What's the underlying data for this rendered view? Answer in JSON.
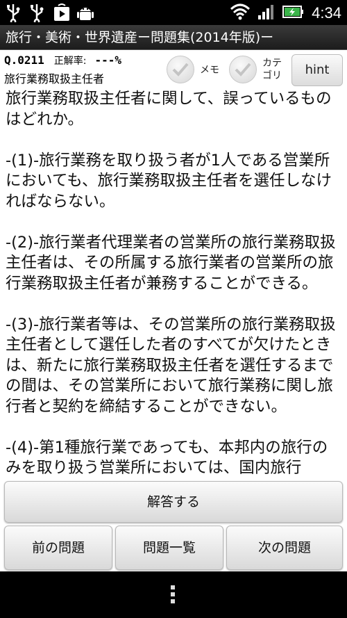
{
  "status_bar": {
    "time": "4:34",
    "icons": [
      "usb-icon",
      "usb-icon",
      "play-store-icon",
      "android-debug-icon",
      "wifi-icon",
      "signal-icon",
      "battery-charging-icon"
    ]
  },
  "app": {
    "title": "旅行・美術・世界遺産ー問題集(2014年版)ー"
  },
  "question": {
    "id": "Q.0211",
    "rate_label": "正解率:",
    "rate_value": "---%",
    "category": "旅行業務取扱主任者",
    "text": "旅行業務取扱主任者に関して、誤っているものはどれか。\n\n-(1)-旅行業務を取り扱う者が1人である営業所においても、旅行業務取扱主任者を選任しなければならない。\n\n-(2)-旅行業者代理業者の営業所の旅行業務取扱主任者は、その所属する旅行業者の営業所の旅行業務取扱主任者が兼務することができる。\n\n-(3)-旅行業者等は、その営業所の旅行業務取扱主任者として選任した者のすべてが欠けたときは、新たに旅行業務取扱主任者を選任するまでの間は、その営業所において旅行業務に関し旅行者と契約を締結することができない。\n\n-(4)-第1種旅行業であっても、本邦内の旅行のみを取り扱う営業所においては、国内旅行"
  },
  "controls": {
    "memo_label": "メモ",
    "category_label": "カテ\nゴリ",
    "hint_label": "hint"
  },
  "buttons": {
    "answer": "解答する",
    "prev": "前の問題",
    "list": "問題一覧",
    "next": "次の問題"
  }
}
